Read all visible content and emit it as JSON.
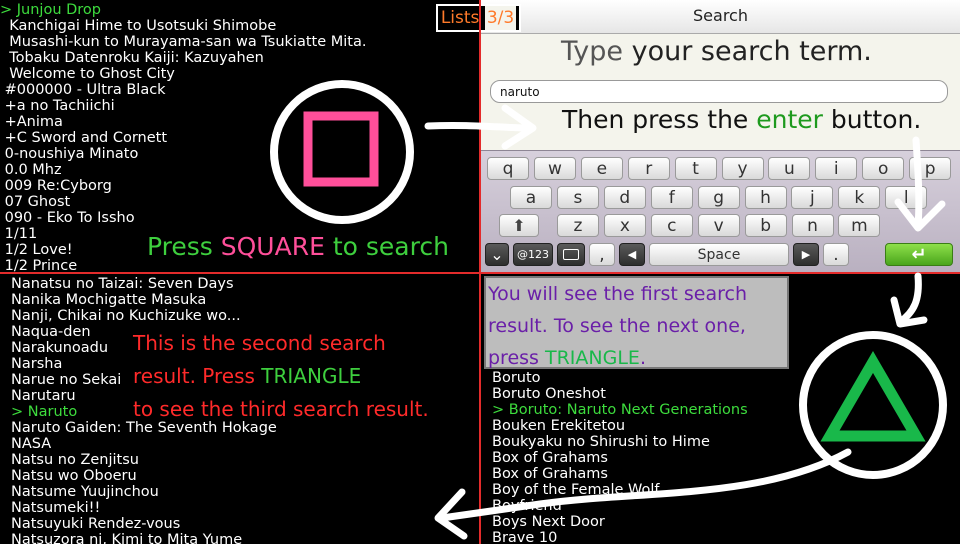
{
  "top_left_list": {
    "items": [
      "> Junjou Drop",
      "  Kanchigai Hime to Usotsuki Shimobe",
      "  Musashi-kun to Murayama-san wa Tsukiatte Mita.",
      "  Tobaku Datenroku Kaiji: Kazuyahen",
      "  Welcome to Ghost City",
      " #000000 - Ultra Black",
      " +a no Tachiichi",
      " +Anima",
      " +C Sword and Cornett",
      " 0-noushiya Minato",
      " 0.0 Mhz",
      " 009 Re:Cyborg",
      " 07 Ghost",
      " 090 - Eko To Issho",
      " 1/11",
      " 1/2 Love!",
      " 1/2 Prince"
    ],
    "selected_index": 0
  },
  "lists_badge": {
    "label": "Lists",
    "count": "3/3"
  },
  "search_dialog": {
    "title": "Search",
    "input_value": "naruto",
    "keyboard": {
      "row1": [
        "q",
        "w",
        "e",
        "r",
        "t",
        "y",
        "u",
        "i",
        "o",
        "p"
      ],
      "row2": [
        "a",
        "s",
        "d",
        "f",
        "g",
        "h",
        "j",
        "k",
        "l"
      ],
      "row3": [
        "z",
        "x",
        "c",
        "v",
        "b",
        "n",
        "m"
      ],
      "shift_symbol": "⬆",
      "hide_symbol": "⌄",
      "numbers_label": "@123",
      "comma": ",",
      "left_arrow": "◀",
      "space_label": "Space",
      "right_arrow": "▶",
      "period": ".",
      "enter_symbol": "↵"
    }
  },
  "annotations": {
    "type_prefix": "Type",
    "type_rest": "your search term.",
    "then_press_pre": "Then press the",
    "then_press_enter": "enter",
    "then_press_post": "button.",
    "press_square_pre": "Press",
    "press_square_word": "SQUARE",
    "press_square_post": "to search",
    "first_result_line1": "You will see the first search",
    "first_result_line2": "result. To see the next one,",
    "first_result_line3_pre": "press",
    "first_result_line3_word": "TRIANGLE",
    "first_result_line3_post": ".",
    "second_line1": "This is the second search",
    "second_line2_pre": "result. Press",
    "second_line2_word": "TRIANGLE",
    "second_line3": "to see the third search result."
  },
  "bottom_left_list": {
    "items": [
      "Nanatsu no Taizai: Seven Days",
      "Nanika Mochigatte Masuka",
      "Nanji, Chikai no Kuchizuke wo...",
      "Naqua-den",
      "Narakunoadu",
      "Narsha",
      "Narue no Sekai",
      "Narutaru",
      "> Naruto",
      "Naruto Gaiden: The Seventh Hokage",
      "NASA",
      "Natsu no Zenjitsu",
      "Natsu wo Oboeru",
      "Natsume Yuujinchou",
      "Natsumeki!!",
      "Natsuyuki Rendez-vous",
      "Natsuzora ni, Kimi to Mita Yume"
    ],
    "selected_index": 8
  },
  "bottom_right_list": {
    "items": [
      "Boruto",
      "Boruto",
      "Boruto Oneshot",
      "> Boruto: Naruto Next Generations",
      "Bouken Erekitetou",
      "Boukyaku no Shirushi to Hime",
      "Box of Grahams",
      "Box of Grahams",
      "Boy of the Female Wolf",
      "Boyfriend",
      "Boys Next Door",
      "Brave 10"
    ],
    "selected_index": 3
  },
  "colors": {
    "selected_green": "#3ddc3d",
    "square_pink": "#ff4f9a",
    "triangle_green": "#19b84a",
    "annotation_green": "#3ecf3e",
    "annotation_red": "#ff2a2a",
    "annotation_purple": "#6a1fa8",
    "badge_orange": "#ff7a2a",
    "divider_red": "#e32b2b"
  },
  "icons": [
    "square-button-icon",
    "triangle-button-icon",
    "shift-icon",
    "keyboard-hide-icon",
    "keyboard-layout-icon",
    "enter-icon",
    "arrow-icon"
  ]
}
